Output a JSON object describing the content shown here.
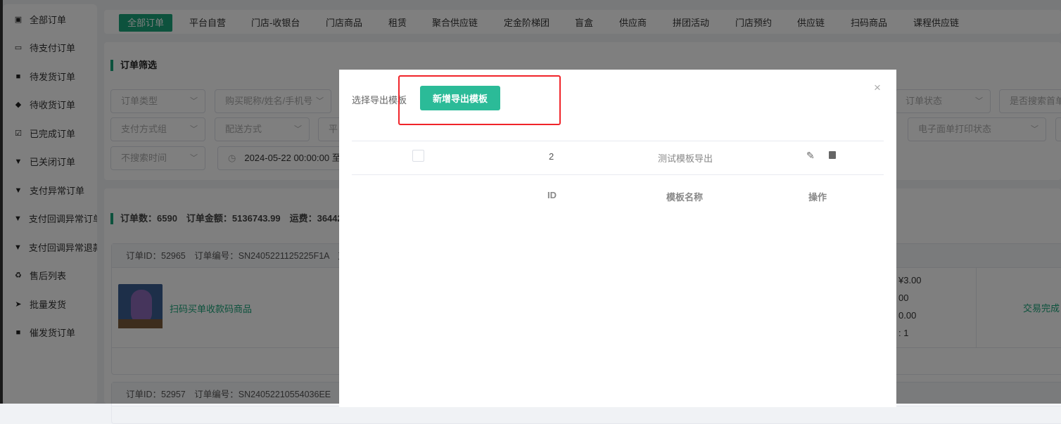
{
  "sidebar": {
    "items": [
      {
        "label": "全部订单",
        "icon": "copy-icon"
      },
      {
        "label": "待支付订单",
        "icon": "credit-card-icon"
      },
      {
        "label": "待发货订单",
        "icon": "truck-icon"
      },
      {
        "label": "待收货订单",
        "icon": "dropbox-icon"
      },
      {
        "label": "已完成订单",
        "icon": "check-square-icon"
      },
      {
        "label": "已关闭订单",
        "icon": "bin-icon"
      },
      {
        "label": "支付异常订单",
        "icon": "bin-icon"
      },
      {
        "label": "支付回调异常订单",
        "icon": "bin-icon"
      },
      {
        "label": "支付回调异常退款",
        "icon": "bin-icon"
      },
      {
        "label": "售后列表",
        "icon": "recycle-icon"
      },
      {
        "label": "批量发货",
        "icon": "send-icon"
      },
      {
        "label": "催发货订单",
        "icon": "truck-icon"
      }
    ]
  },
  "tabs": [
    "全部订单",
    "平台自营",
    "门店-收银台",
    "门店商品",
    "租赁",
    "聚合供应链",
    "定金阶梯团",
    "盲盒",
    "供应商",
    "拼团活动",
    "门店预约",
    "供应链",
    "扫码商品",
    "课程供应链"
  ],
  "filter": {
    "title": "订单筛选",
    "fields": {
      "order_type": "订单类型",
      "buyer": "购买昵称/姓名/手机号",
      "order_status": "订单状态",
      "first_order": "是否搜索首单",
      "pay_group": "支付方式组",
      "delivery": "配送方式",
      "platform": "平",
      "print_status": "电子面单打印状态",
      "time_mode": "不搜索时间",
      "date_start": "2024-05-22 00:00:00",
      "date_sep": "至"
    }
  },
  "stats": {
    "text": "订单数：6590　订单金额：5136743.99　运费：36442."
  },
  "orders": [
    {
      "head": "订单ID：52965　订单编号：SN2405221125225F1A　支",
      "product": "扫码买单收款码商品",
      "price_lines": [
        "¥3.00",
        "00",
        "0.00",
        ":  1"
      ],
      "status": "交易完成"
    },
    {
      "head": "订单ID：52957　订单编号：SN24052210554036EE　支"
    }
  ],
  "modal": {
    "label": "选择导出模板",
    "add_button": "新增导出模板",
    "close": "×",
    "columns": [
      "ID",
      "模板名称",
      "操作"
    ],
    "rows": [
      {
        "id": "2",
        "name": "测试模板导出"
      }
    ]
  },
  "colors": {
    "accent": "#1aa57a",
    "button": "#2bbb98",
    "highlight": "#f0242a"
  }
}
